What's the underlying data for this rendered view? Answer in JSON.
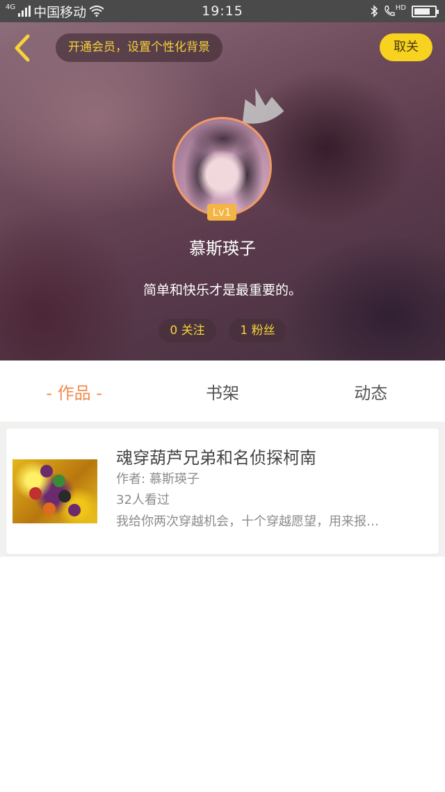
{
  "status_bar": {
    "network_type": "4G",
    "carrier": "中国移动",
    "time": "19:15",
    "hd_label": "HD",
    "battery_level": 0.8,
    "icons": [
      "signal-icon",
      "wifi-icon",
      "bluetooth-icon",
      "hd-call-icon",
      "battery-icon"
    ]
  },
  "header": {
    "back_icon": "chevron-left-icon",
    "vip_banner": "开通会员，设置个性化背景",
    "close_label": "取关",
    "crown_icon": "crown-icon",
    "level_badge": "Lv1",
    "user_name": "慕斯瑛子",
    "bio": "简单和快乐才是最重要的。",
    "following": "0 关注",
    "fans": "1 粉丝",
    "accent_color": "#f7d21e",
    "avatar_border_color": "#f39a63"
  },
  "tabs": {
    "items": [
      {
        "label": "- 作品 -",
        "active": true
      },
      {
        "label": "书架",
        "active": false
      },
      {
        "label": "动态",
        "active": false
      }
    ],
    "active_color": "#f28a4e"
  },
  "works": [
    {
      "title": "魂穿葫芦兄弟和名侦探柯南",
      "author": "作者: 慕斯瑛子",
      "views": "32人看过",
      "description": "我给你两次穿越机会，十个穿越愿望，用来报…"
    }
  ]
}
